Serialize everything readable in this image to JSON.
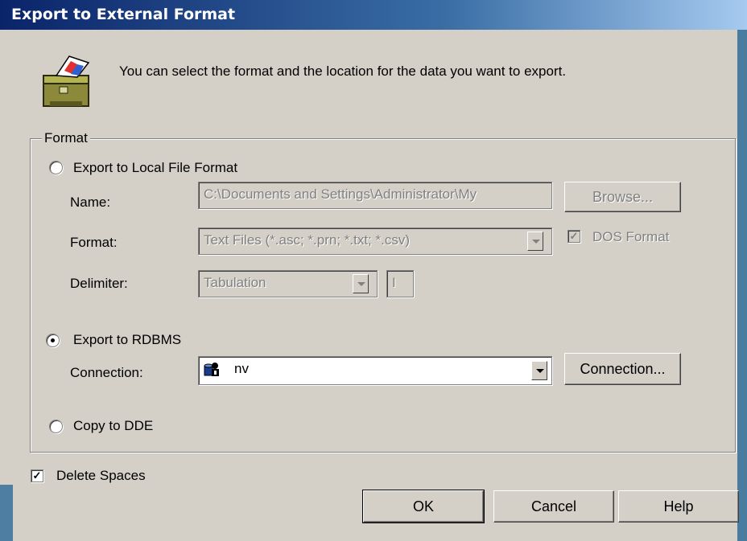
{
  "window": {
    "title": "Export to External Format"
  },
  "intro": {
    "text": "You can select the format and the location for the data you want to export."
  },
  "format_group": {
    "legend": "Format",
    "local_file": {
      "label": "Export to Local File Format",
      "checked": false,
      "name_label": "Name:",
      "name_value": "C:\\Documents and Settings\\Administrator\\My",
      "browse_label": "Browse...",
      "format_label": "Format:",
      "format_value": "Text Files (*.asc; *.prn; *.txt; *.csv)",
      "dos_format_label": "DOS Format",
      "dos_format_checked": true,
      "delimiter_label": "Delimiter:",
      "delimiter_value": "Tabulation",
      "delimiter_char": "I"
    },
    "rdbms": {
      "label": "Export to RDBMS",
      "checked": true,
      "connection_label": "Connection:",
      "connection_value": "nv",
      "connection_button_label": "Connection..."
    },
    "dde": {
      "label": "Copy to DDE",
      "checked": false
    }
  },
  "delete_spaces": {
    "label": "Delete Spaces",
    "checked": true
  },
  "buttons": {
    "ok": "OK",
    "cancel": "Cancel",
    "help": "Help"
  },
  "icons": {
    "app": "export-briefcase-icon",
    "connection": "database-user-icon"
  },
  "colors": {
    "dialog_bg": "#d4d0c8",
    "titlebar_start": "#0a246a",
    "titlebar_end": "#a6caf0"
  }
}
